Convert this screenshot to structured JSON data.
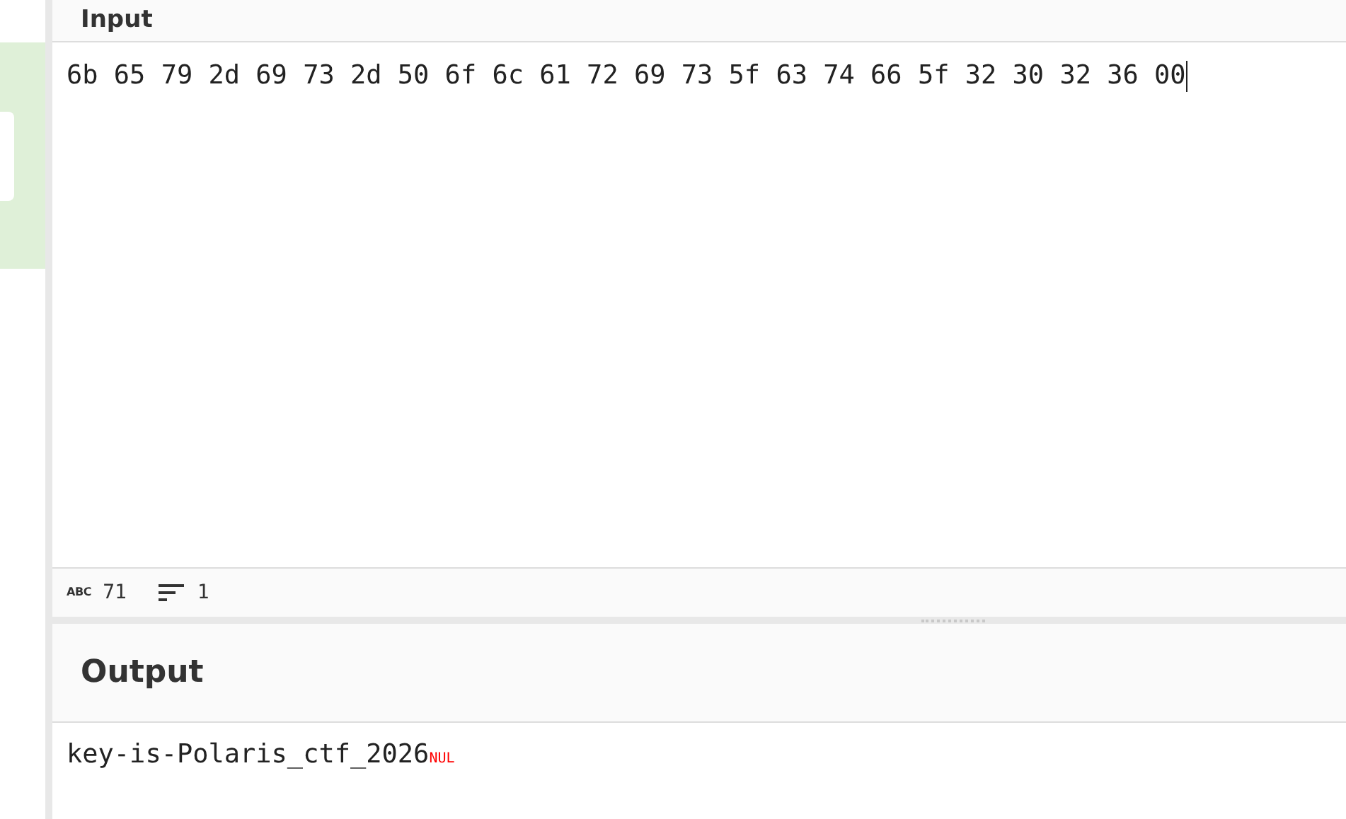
{
  "input": {
    "title": "Input",
    "value": "6b 65 79 2d 69 73 2d 50 6f 6c 61 72 69 73 5f 63 74 66 5f 32 30 32 36 00",
    "status": {
      "abc_label": "ABC",
      "length": "71",
      "lines": "1"
    }
  },
  "output": {
    "title": "Output",
    "text": "key-is-Polaris_ctf_2026",
    "control_char": "NUL"
  }
}
